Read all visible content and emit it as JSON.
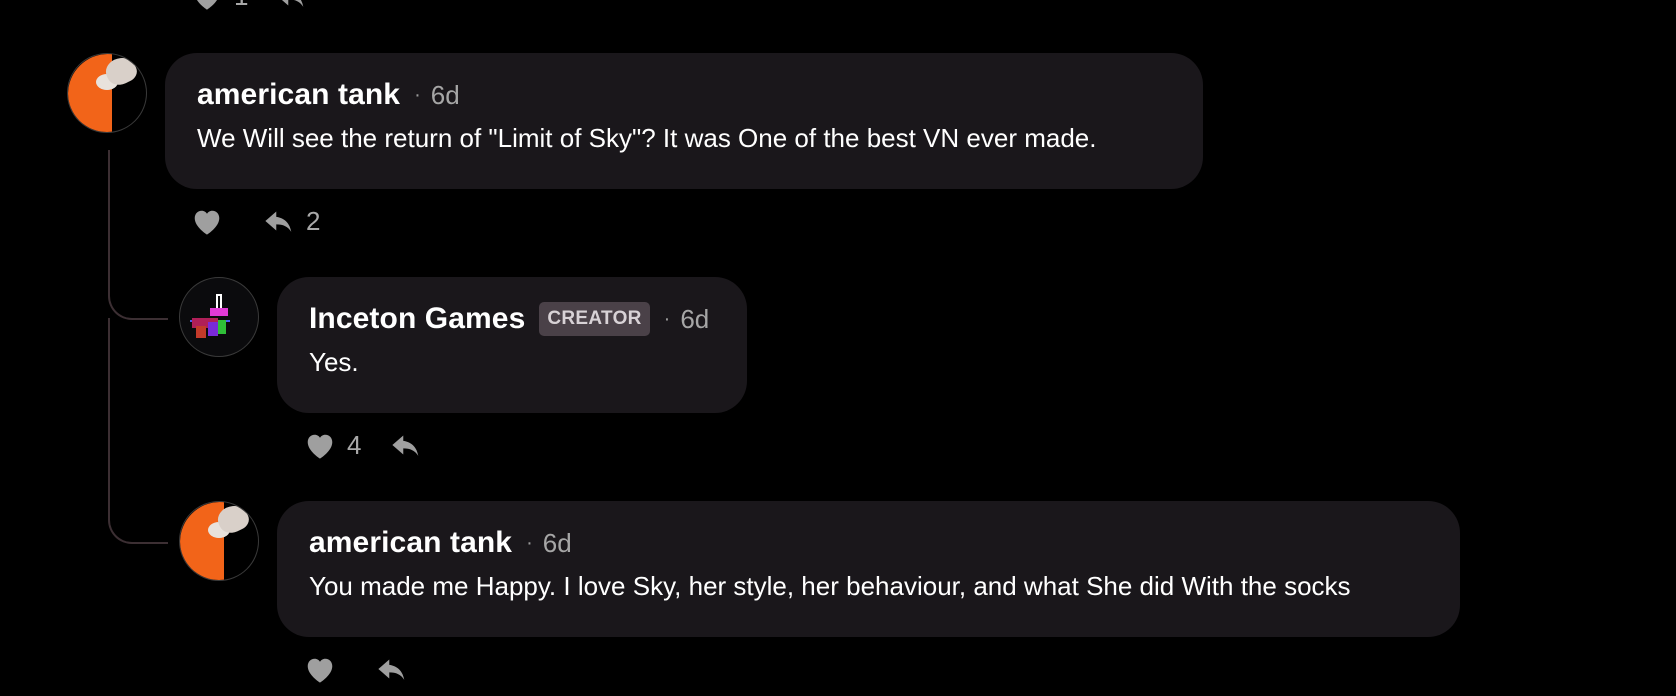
{
  "top_row": {
    "like_count": "1"
  },
  "comments": [
    {
      "author": "american tank",
      "separator": "·",
      "time": "6d",
      "text": "We Will see the return of \"Limit of Sky\"? It was One of the best VN ever made.",
      "like_count": "",
      "reply_count": "2"
    },
    {
      "author": "Inceton Games",
      "badge": "CREATOR",
      "separator": "·",
      "time": "6d",
      "text": "Yes.",
      "like_count": "4",
      "reply_count": ""
    },
    {
      "author": "american tank",
      "separator": "·",
      "time": "6d",
      "text": "You made me Happy. I love Sky, her style, her behaviour, and what She did With the socks",
      "like_count": "",
      "reply_count": ""
    }
  ],
  "icons": {
    "like": "heart-icon",
    "reply": "reply-arrow-icon"
  },
  "colors": {
    "background": "#000000",
    "bubble": "#1a171b",
    "badge": "#4a4148",
    "accent_orange": "#f26419"
  }
}
